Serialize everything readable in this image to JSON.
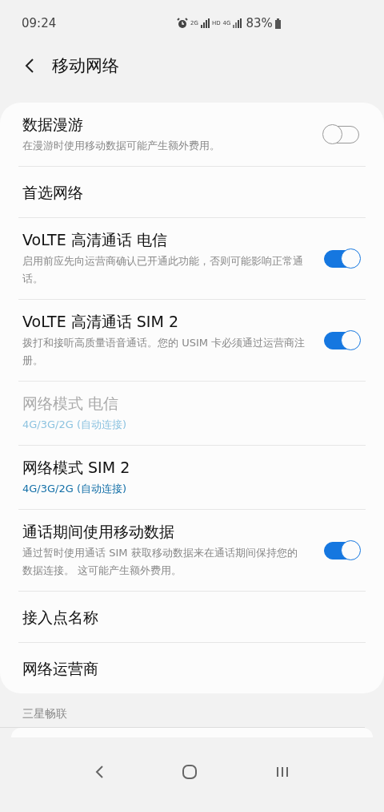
{
  "status_bar": {
    "time": "09:24",
    "sim1_network": "2G",
    "hd": "HD",
    "sim2_network": "4G",
    "battery": "83%"
  },
  "header": {
    "title": "移动网络"
  },
  "settings": [
    {
      "kind": "toggle",
      "title": "数据漫游",
      "subtitle": "在漫游时使用移动数据可能产生额外费用。",
      "on": false,
      "disabled": false
    },
    {
      "kind": "link",
      "title": "首选网络",
      "disabled": false
    },
    {
      "kind": "toggle",
      "title": "VoLTE 高清通话 电信",
      "subtitle": "启用前应先向运营商确认已开通此功能，否则可能影响正常通话。",
      "on": true,
      "disabled": false
    },
    {
      "kind": "toggle",
      "title": "VoLTE 高清通话 SIM 2",
      "subtitle": "拨打和接听高质量语音通话。您的 USIM 卡必须通过运营商注册。",
      "on": true,
      "disabled": false
    },
    {
      "kind": "value",
      "title": "网络模式 电信",
      "subtitle": "4G/3G/2G (自动连接)",
      "disabled": true
    },
    {
      "kind": "value",
      "title": "网络模式 SIM 2",
      "subtitle": "4G/3G/2G (自动连接)",
      "disabled": false
    },
    {
      "kind": "toggle",
      "title": "通话期间使用移动数据",
      "subtitle": "通过暂时使用通话 SIM 获取移动数据来在通话期间保持您的数据连接。 这可能产生额外费用。",
      "on": true,
      "disabled": false
    },
    {
      "kind": "link",
      "title": "接入点名称",
      "disabled": false
    },
    {
      "kind": "link",
      "title": "网络运营商",
      "disabled": false
    }
  ],
  "section": {
    "title": "三星畅联"
  }
}
